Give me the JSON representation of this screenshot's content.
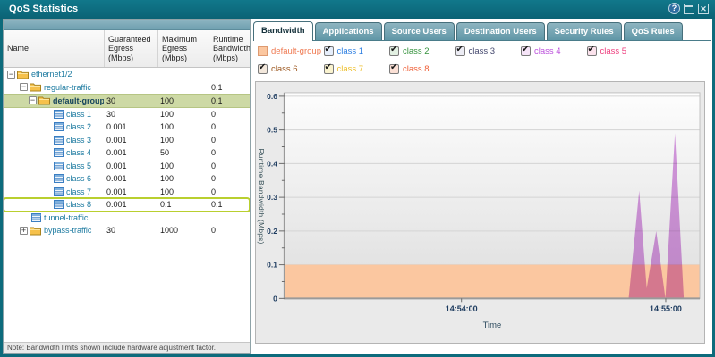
{
  "window": {
    "title": "QoS Statistics",
    "controls": {
      "help": "?",
      "restore": "",
      "close": "✕"
    }
  },
  "left_panel": {
    "columns": [
      "Name",
      "Guaranteed\nEgress\n(Mbps)",
      "Maximum\nEgress\n(Mbps)",
      "Runtime\nBandwidth\n(Mbps)"
    ],
    "rows": [
      {
        "name": "ethernet1/2",
        "pad": 4,
        "icon": "folder",
        "expander": "-",
        "g": "",
        "m": "",
        "r": "",
        "highlight": ""
      },
      {
        "name": "regular-traffic",
        "pad": 18,
        "icon": "folder",
        "expander": "-",
        "g": "",
        "m": "",
        "r": "0.1",
        "highlight": ""
      },
      {
        "name": "default-group",
        "pad": 28,
        "icon": "folder",
        "expander": "-",
        "g": "30",
        "m": "100",
        "r": "0.1",
        "highlight": "selected"
      },
      {
        "name": "class 1",
        "pad": 54,
        "icon": "class",
        "expander": "",
        "g": "30",
        "m": "100",
        "r": "0",
        "highlight": ""
      },
      {
        "name": "class 2",
        "pad": 54,
        "icon": "class",
        "expander": "",
        "g": "0.001",
        "m": "100",
        "r": "0",
        "highlight": ""
      },
      {
        "name": "class 3",
        "pad": 54,
        "icon": "class",
        "expander": "",
        "g": "0.001",
        "m": "100",
        "r": "0",
        "highlight": ""
      },
      {
        "name": "class 4",
        "pad": 54,
        "icon": "class",
        "expander": "",
        "g": "0.001",
        "m": "50",
        "r": "0",
        "highlight": ""
      },
      {
        "name": "class 5",
        "pad": 54,
        "icon": "class",
        "expander": "",
        "g": "0.001",
        "m": "100",
        "r": "0",
        "highlight": ""
      },
      {
        "name": "class 6",
        "pad": 54,
        "icon": "class",
        "expander": "",
        "g": "0.001",
        "m": "100",
        "r": "0",
        "highlight": ""
      },
      {
        "name": "class 7",
        "pad": 54,
        "icon": "class",
        "expander": "",
        "g": "0.001",
        "m": "100",
        "r": "0",
        "highlight": ""
      },
      {
        "name": "class 8",
        "pad": 54,
        "icon": "class",
        "expander": "",
        "g": "0.001",
        "m": "0.1",
        "r": "0.1",
        "highlight": "outline"
      },
      {
        "name": "tunnel-traffic",
        "pad": 29,
        "icon": "class",
        "expander": "",
        "g": "",
        "m": "",
        "r": "",
        "highlight": ""
      },
      {
        "name": "bypass-traffic",
        "pad": 18,
        "icon": "folder",
        "expander": "+",
        "g": "30",
        "m": "1000",
        "r": "0",
        "highlight": ""
      }
    ],
    "note": "Note: Bandwidth limits shown include hardware adjustment factor."
  },
  "tabs": [
    {
      "label": "Bandwidth",
      "active": true
    },
    {
      "label": "Applications",
      "active": false
    },
    {
      "label": "Source Users",
      "active": false
    },
    {
      "label": "Destination Users",
      "active": false
    },
    {
      "label": "Security Rules",
      "active": false
    },
    {
      "label": "QoS Rules",
      "active": false
    }
  ],
  "legend": [
    {
      "label": "default-group",
      "color": "#ef7a52",
      "swatch": "#fbc7a0",
      "checkbox": false,
      "checked": false,
      "tint": "#fbc7a0"
    },
    {
      "label": "class 1",
      "color": "#2a7de1",
      "checkbox": true,
      "checked": true,
      "tint": "#e6eefb"
    },
    {
      "label": "class 2",
      "color": "#33913b",
      "checkbox": true,
      "checked": true,
      "tint": "#e2f0e2"
    },
    {
      "label": "class 3",
      "color": "#44486e",
      "checkbox": true,
      "checked": true,
      "tint": "#ececf4"
    },
    {
      "label": "class 4",
      "color": "#bb4fdc",
      "checkbox": true,
      "checked": true,
      "tint": "#f6e4f8"
    },
    {
      "label": "class 5",
      "color": "#ee3d7d",
      "checkbox": true,
      "checked": true,
      "tint": "#fbe2ec"
    },
    {
      "label": "class 6",
      "color": "#9c571f",
      "checkbox": true,
      "checked": true,
      "tint": "#f3e8dc"
    },
    {
      "label": "class 7",
      "color": "#edbe2a",
      "checkbox": true,
      "checked": true,
      "tint": "#faf3cf"
    },
    {
      "label": "class 8",
      "color": "#ef6038",
      "checkbox": true,
      "checked": true,
      "tint": "#fbe0d5"
    }
  ],
  "chart_data": {
    "type": "area",
    "title": "",
    "xlabel": "Time",
    "ylabel": "Runtime Bandwidth (Mbps)",
    "ylim": [
      0,
      0.6
    ],
    "y_tick_step": 0.1,
    "y_minor_tick_step": 0.05,
    "grid": true,
    "x_axis": {
      "range_seconds": 122,
      "window_start_time": "14:53:08",
      "ticks": [
        {
          "label": "14:54:00",
          "t": 52
        },
        {
          "label": "14:55:00",
          "t": 112
        }
      ]
    },
    "series": [
      {
        "name": "default-group",
        "render": "constant-area",
        "color": "#fbc7a0",
        "constant_value": 0.1
      },
      {
        "name": "class 4",
        "render": "points-area",
        "color": "#d89ae2",
        "blend": "multiply",
        "points": [
          {
            "t": 101.1,
            "v": 0
          },
          {
            "t": 104.2,
            "v": 0.32
          },
          {
            "t": 106.4,
            "v": 0.03
          },
          {
            "t": 109.2,
            "v": 0.2
          },
          {
            "t": 111.9,
            "v": 0
          },
          {
            "t": 114.7,
            "v": 0.49
          },
          {
            "t": 117.3,
            "v": 0
          }
        ]
      }
    ],
    "legend_position": "top"
  }
}
